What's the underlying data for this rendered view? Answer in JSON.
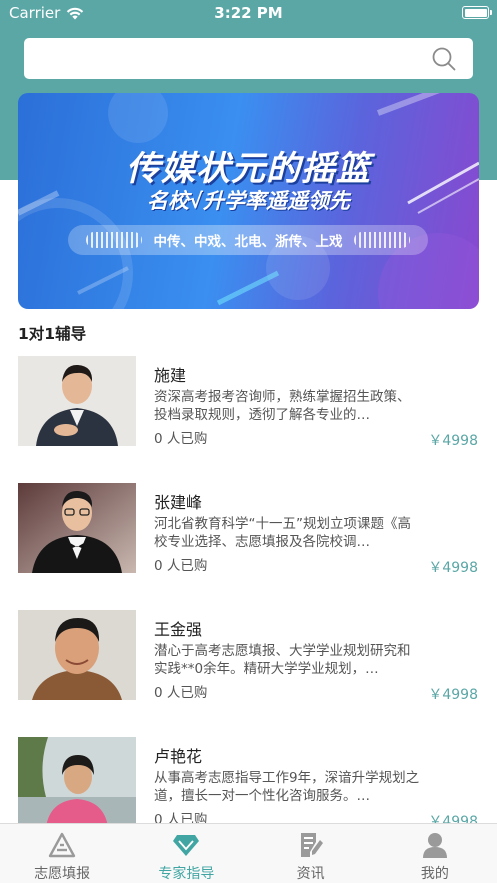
{
  "status_bar": {
    "carrier": "Carrier",
    "time": "3:22 PM"
  },
  "search": {
    "placeholder": "",
    "value": ""
  },
  "banner": {
    "title": "传媒状元的摇篮",
    "subtitle": "名校√升学率遥遥领先",
    "tagline": "中传、中戏、北电、浙传、上戏"
  },
  "section": {
    "title": "1对1辅导"
  },
  "experts": [
    {
      "name": "施建",
      "description": "资深高考报考咨询师，熟练掌握招生政策、投档录取规则，透彻了解各专业的…",
      "sold": "0 人已购",
      "price": "￥4998"
    },
    {
      "name": "张建峰",
      "description": "河北省教育科学“十一五”规划立项课题《高校专业选择、志愿填报及各院校调…",
      "sold": "0 人已购",
      "price": "￥4998"
    },
    {
      "name": "王金强",
      "description": "潜心于高考志愿填报、大学学业规划研究和实践**0余年。精研大学学业规划，…",
      "sold": "0 人已购",
      "price": "￥4998"
    },
    {
      "name": "卢艳花",
      "description": "从事高考志愿指导工作9年，深谙升学规划之道，擅长一对一个性化咨询服务。…",
      "sold": "0 人已购",
      "price": "￥4998"
    }
  ],
  "tabbar": {
    "tabs": [
      {
        "label": "志愿填报",
        "icon": "triangle-logo-icon",
        "active": false
      },
      {
        "label": "专家指导",
        "icon": "diamond-icon",
        "active": true
      },
      {
        "label": "资讯",
        "icon": "document-edit-icon",
        "active": false
      },
      {
        "label": "我的",
        "icon": "user-icon",
        "active": false
      }
    ]
  },
  "colors": {
    "accent": "#5aa7a6",
    "active_tab": "#41a6a3",
    "price": "#5aa7a6"
  }
}
